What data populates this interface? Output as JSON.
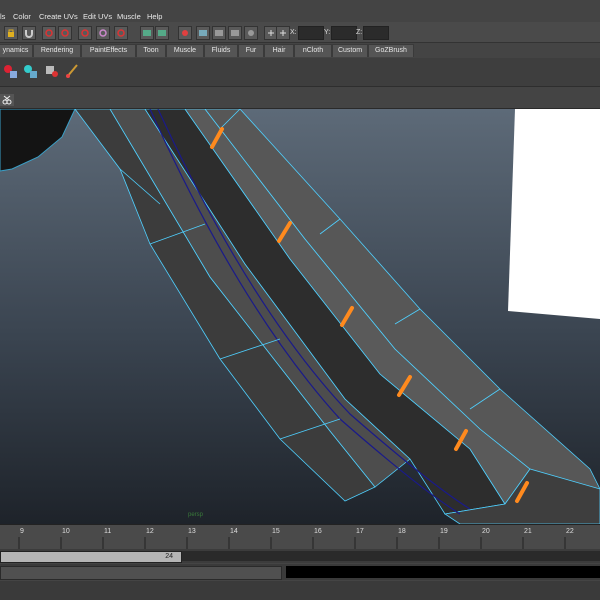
{
  "menus": [
    "ls",
    "Color",
    "Create UVs",
    "Edit UVs",
    "Muscle",
    "Help"
  ],
  "coords": {
    "x_label": "X:",
    "y_label": "Y:",
    "z_label": "Z:"
  },
  "shelf_tabs": [
    "ynamics",
    "Rendering",
    "PaintEffects",
    "Toon",
    "Muscle",
    "Fluids",
    "Fur",
    "Hair",
    "nCloth",
    "Custom",
    "GoZBrush"
  ],
  "viewport": {
    "camera_label": "persp"
  },
  "timeline": {
    "ticks": [
      "9",
      "10",
      "11",
      "12",
      "13",
      "14",
      "15",
      "16",
      "17",
      "18",
      "19",
      "20",
      "21",
      "22"
    ]
  },
  "range": {
    "end_frame": "24"
  },
  "colors": {
    "accent_orange": "#ff8a1e",
    "wire_cyan": "#4fd0ff",
    "curve_blue": "#1a1a8a"
  }
}
